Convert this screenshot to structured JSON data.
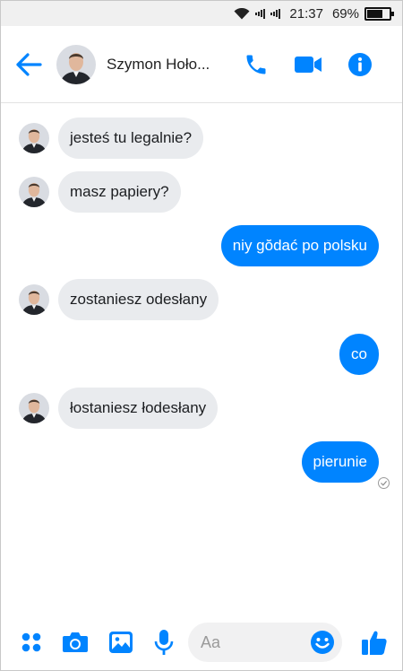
{
  "status_bar": {
    "time": "21:37",
    "battery_text": "69%",
    "battery_level": 0.69
  },
  "header": {
    "contact_name": "Szymon Hoło...",
    "back_icon": "back-arrow-icon",
    "actions": [
      "phone-call-icon",
      "video-call-icon",
      "info-icon"
    ]
  },
  "conversation": {
    "messages": [
      {
        "direction": "incoming",
        "text": "jesteś tu legalnie?"
      },
      {
        "direction": "incoming",
        "text": "masz papiery?"
      },
      {
        "direction": "outgoing",
        "text": "niy gŏdać po polsku"
      },
      {
        "direction": "incoming",
        "text": "zostaniesz odesłany"
      },
      {
        "direction": "outgoing",
        "text": "co"
      },
      {
        "direction": "incoming",
        "text": "łostaniesz łodesłany"
      },
      {
        "direction": "outgoing",
        "text": "pierunie"
      }
    ]
  },
  "composer": {
    "placeholder": "Aa",
    "buttons": [
      "apps-grid-icon",
      "camera-icon",
      "gallery-icon",
      "microphone-icon",
      "emoji-icon",
      "thumbs-up-icon"
    ]
  },
  "colors": {
    "accent": "#0084ff",
    "incoming_bubble": "#e9ebee",
    "divider": "#e2e2e2"
  }
}
